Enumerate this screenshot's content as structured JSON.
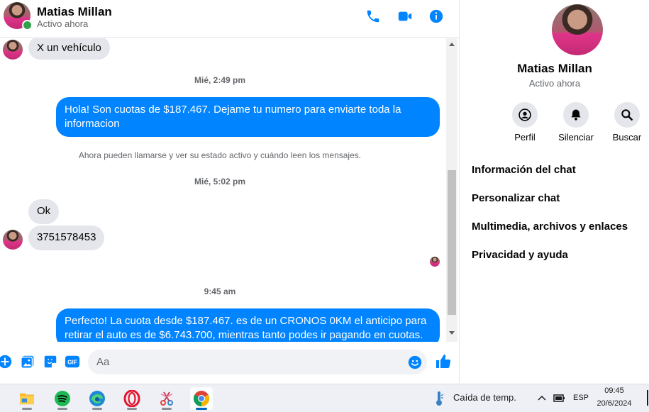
{
  "contact": {
    "name": "Matias Millan",
    "status": "Activo ahora"
  },
  "header_icons": [
    "phone-icon",
    "video-camera-icon",
    "info-icon"
  ],
  "messages": {
    "m1": "X un vehículo",
    "ts1": "Mié, 2:49 pm",
    "m2": "Hola! Son cuotas de $187.467. Dejame tu numero para enviarte toda la informacion",
    "notice": "Ahora pueden llamarse y ver su estado activo y cuándo leen los mensajes.",
    "ts2": "Mié, 5:02 pm",
    "m3": "Ok",
    "m4": "3751578453",
    "ts3": "9:45 am",
    "m5": "Perfecto! La cuota desde $187.467. es de un CRONOS 0KM el anticipo para retirar el auto es de $6.743.700, mientras tanto podes ir pagando en cuotas."
  },
  "composer": {
    "placeholder": "Aa"
  },
  "panel": {
    "actions": [
      "Perfil",
      "Silenciar",
      "Buscar"
    ],
    "menu": [
      "Información del chat",
      "Personalizar chat",
      "Multimedia, archivos y enlaces",
      "Privacidad y ayuda"
    ]
  },
  "taskbar": {
    "weather": "Caída de temp.",
    "lang": "ESP",
    "time": "09:45",
    "date": "20/6/2024"
  },
  "colors": {
    "accent": "#0084ff",
    "online": "#31a24c",
    "bubble_in": "#e4e6eb"
  }
}
